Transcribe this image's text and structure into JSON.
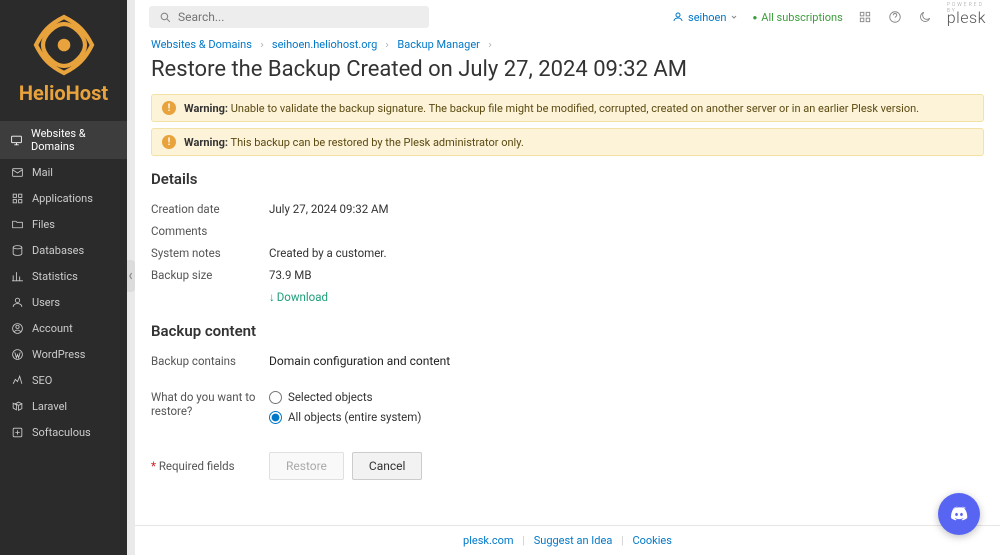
{
  "brand": "HelioHost",
  "search_placeholder": "Search...",
  "user": {
    "name": "seihoen"
  },
  "subscriptions_label": "All subscriptions",
  "plesk_powered": "POWERED BY",
  "plesk_brand": "plesk",
  "sidebar": {
    "items": [
      {
        "label": "Websites & Domains"
      },
      {
        "label": "Mail"
      },
      {
        "label": "Applications"
      },
      {
        "label": "Files"
      },
      {
        "label": "Databases"
      },
      {
        "label": "Statistics"
      },
      {
        "label": "Users"
      },
      {
        "label": "Account"
      },
      {
        "label": "WordPress"
      },
      {
        "label": "SEO"
      },
      {
        "label": "Laravel"
      },
      {
        "label": "Softaculous"
      }
    ]
  },
  "breadcrumbs": [
    {
      "label": "Websites & Domains"
    },
    {
      "label": "seihoen.heliohost.org"
    },
    {
      "label": "Backup Manager"
    }
  ],
  "page_title": "Restore the Backup Created on July 27, 2024 09:32 AM",
  "alerts": [
    {
      "prefix": "Warning:",
      "text": "Unable to validate the backup signature. The backup file might be modified, corrupted, created on another server or in an earlier Plesk version."
    },
    {
      "prefix": "Warning:",
      "text": "This backup can be restored by the Plesk administrator only."
    }
  ],
  "details": {
    "heading": "Details",
    "rows": {
      "creation_date": {
        "label": "Creation date",
        "value": "July 27, 2024 09:32 AM"
      },
      "comments": {
        "label": "Comments",
        "value": ""
      },
      "system_notes": {
        "label": "System notes",
        "value": "Created by a customer."
      },
      "backup_size": {
        "label": "Backup size",
        "value": "73.9 MB"
      },
      "download": {
        "label": "",
        "link": "Download"
      }
    }
  },
  "backup_content": {
    "heading": "Backup content",
    "contains": {
      "label": "Backup contains",
      "value": "Domain configuration and content"
    },
    "restore_q": {
      "label": "What do you want to restore?",
      "options": [
        {
          "label": "Selected objects",
          "checked": false
        },
        {
          "label": "All objects (entire system)",
          "checked": true
        }
      ]
    }
  },
  "required_note": "Required fields",
  "buttons": {
    "restore": "Restore",
    "cancel": "Cancel"
  },
  "footer": {
    "a": "plesk.com",
    "b": "Suggest an Idea",
    "c": "Cookies"
  }
}
